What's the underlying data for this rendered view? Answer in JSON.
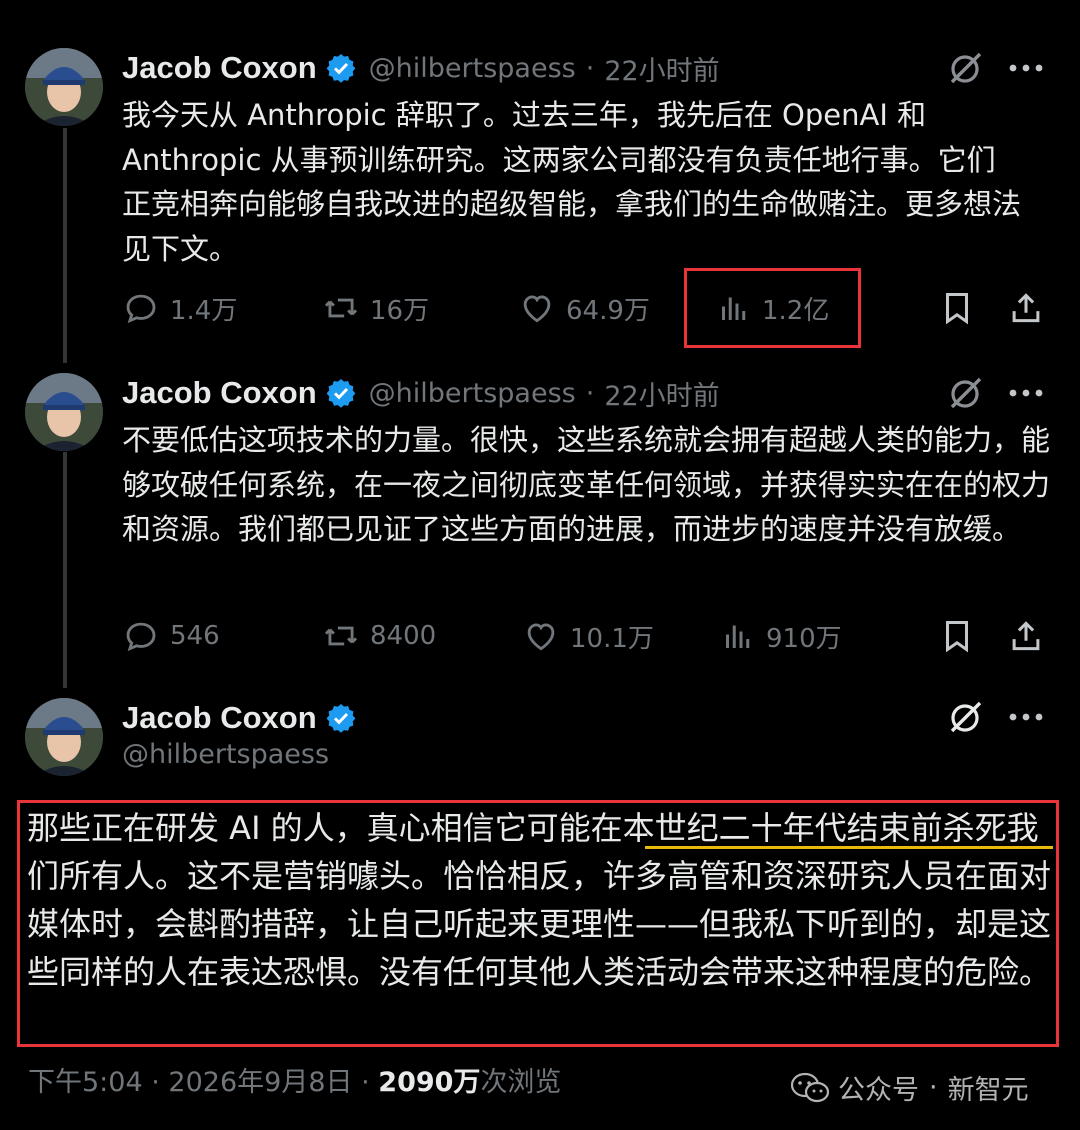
{
  "tweets": [
    {
      "name": "Jacob Coxon",
      "handle": "@hilbertspaess",
      "sep": "·",
      "time": "22小时前",
      "text": "我今天从 Anthropic 辞职了。过去三年，我先后在 OpenAI 和 Anthropic 从事预训练研究。这两家公司都没有负责任地行事。它们正竞相奔向能够自我改进的超级智能，拿我们的生命做赌注。更多想法见下文。",
      "replies": "1.4万",
      "reposts": "16万",
      "likes": "64.9万",
      "views": "1.2亿"
    },
    {
      "name": "Jacob Coxon",
      "handle": "@hilbertspaess",
      "sep": "·",
      "time": "22小时前",
      "text": "不要低估这项技术的力量。很快，这些系统就会拥有超越人类的能力，能够攻破任何系统，在一夜之间彻底变革任何领域，并获得实实在在的权力和资源。我们都已见证了这些方面的进展，而进步的速度并没有放缓。",
      "replies": "546",
      "reposts": "8400",
      "likes": "10.1万",
      "views": "910万"
    },
    {
      "name": "Jacob Coxon",
      "handle": "@hilbertspaess",
      "text": "那些正在研发 AI 的人，真心相信它可能在本世纪二十年代结束前杀死我们所有人。这不是营销噱头。恰恰相反，许多高管和资深研究人员在面对媒体时，会斟酌措辞，让自己听起来更理性——但我私下听到的，却是这些同样的人在表达恐惧。没有任何其他人类活动会带来这种程度的危险。"
    }
  ],
  "footer": {
    "time": "下午5:04",
    "sep1": "·",
    "date": "2026年9月8日",
    "sep2": "·",
    "views_count": "2090万",
    "views_label": "次浏览"
  },
  "watermark": {
    "left": "公众号",
    "sep": "·",
    "right": "新智元"
  },
  "colors": {
    "background": "#000000",
    "text": "#e7e9ea",
    "muted": "#71767b",
    "verified": "#1d9bf0",
    "highlight": "#e8353a",
    "underline": "#e9b90b"
  }
}
